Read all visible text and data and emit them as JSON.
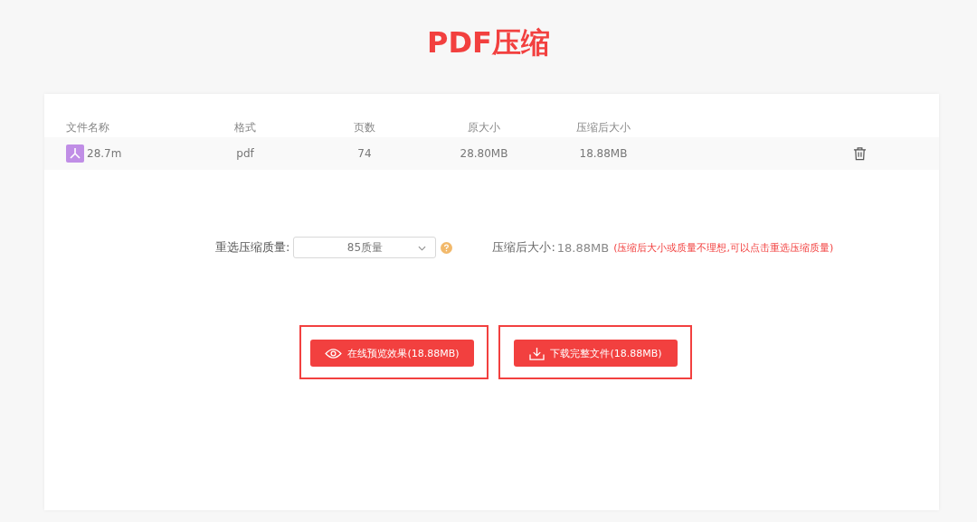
{
  "title": "PDF压缩",
  "table": {
    "columns": [
      "文件名称",
      "格式",
      "页数",
      "原大小",
      "压缩后大小"
    ],
    "rows": [
      {
        "name": "28.7m",
        "format": "pdf",
        "pages": "74",
        "original_size": "28.80MB",
        "compressed_size": "18.88MB"
      }
    ]
  },
  "quality": {
    "label": "重选压缩质量:",
    "value": "85质量"
  },
  "result": {
    "label": "压缩后大小:",
    "value": "18.88MB",
    "hint": "(压缩后大小或质量不理想,可以点击重选压缩质量)"
  },
  "buttons": [
    {
      "kind": "preview",
      "label": "在线预览效果(18.88MB)",
      "highlighted": true
    },
    {
      "kind": "download",
      "label": "下载完整文件(18.88MB)",
      "highlighted": true
    }
  ]
}
